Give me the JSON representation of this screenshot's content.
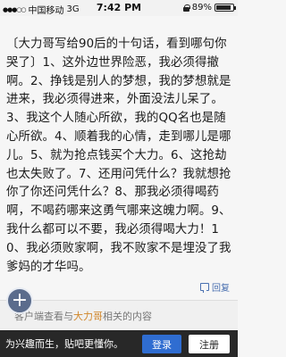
{
  "status_bar": {
    "carrier": "中国移动",
    "network": "3G",
    "time": "7:42 PM",
    "battery_percent": "89%",
    "battery_level": 0.89
  },
  "post": {
    "content": "〔大力哥写给90后的十句话，看到哪句你哭了〕1、这外边世界险恶，我必须得撤啊。2、挣钱是别人的梦想，我的梦想就是进来，我必须得进来，外面没法儿呆了。3、我这个人随心所欲，我的QQ名也是随心所欲。4、顺着我的心情，走到哪儿是哪儿。5、就为抢点钱买个大力。6、这抢劫也太失败了。7、还用问凭什么？我就想抢你了你还问凭什么？8、那我必须得喝药啊，不喝药哪来这勇气哪来这魄力啊。9、我什么都可以不要，我必须得喝大力！10、我必须败家啊，我不败家不是埋没了我爹妈的才华吗。",
    "reply_label": "回复"
  },
  "more": {
    "prefix": "客户端查看与",
    "highlight": "大力哥",
    "suffix": "相关的内容"
  },
  "login_bar": {
    "prompt": "为兴趣而生，贴吧更懂你。",
    "login_label": "登录",
    "register_label": "注册"
  },
  "fab_symbol": "+"
}
